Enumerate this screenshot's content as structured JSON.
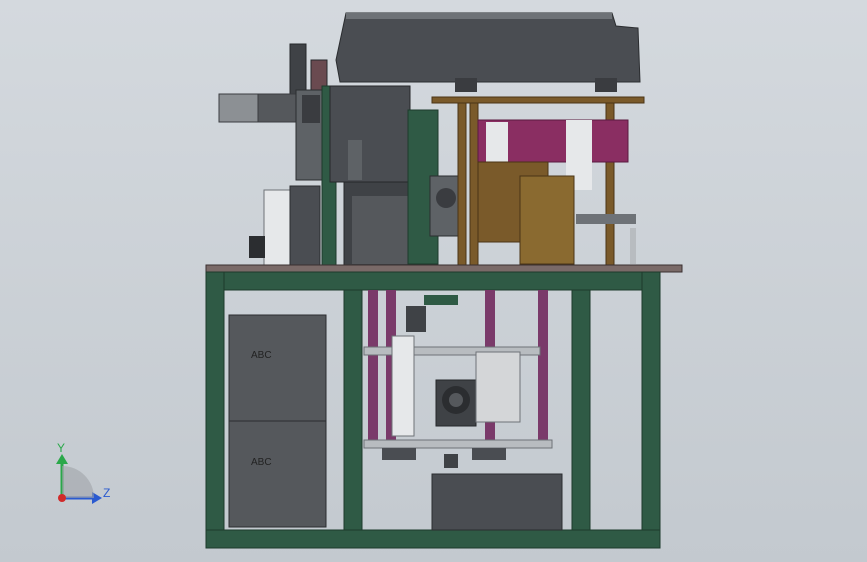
{
  "viewport": {
    "background_top": "#d4d9de",
    "background_bottom": "#c3c9cf"
  },
  "colors": {
    "frame_green": "#2f5a45",
    "dark_gray": "#4a4d52",
    "mid_gray": "#6e7277",
    "light_gray": "#b8bcc0",
    "wood": "#7a5a2a",
    "magenta": "#8a2e62",
    "purple": "#7a3a6a",
    "cabinet": "#55585c",
    "white_part": "#e6e8ea"
  },
  "cabinets": {
    "upper_label": "ABC",
    "lower_label": "ABC"
  },
  "triad": {
    "y_label": "Y",
    "z_label": "Z",
    "y_color": "#2aa84a",
    "z_color": "#2a5ad0",
    "origin_color": "#d02a2a"
  }
}
